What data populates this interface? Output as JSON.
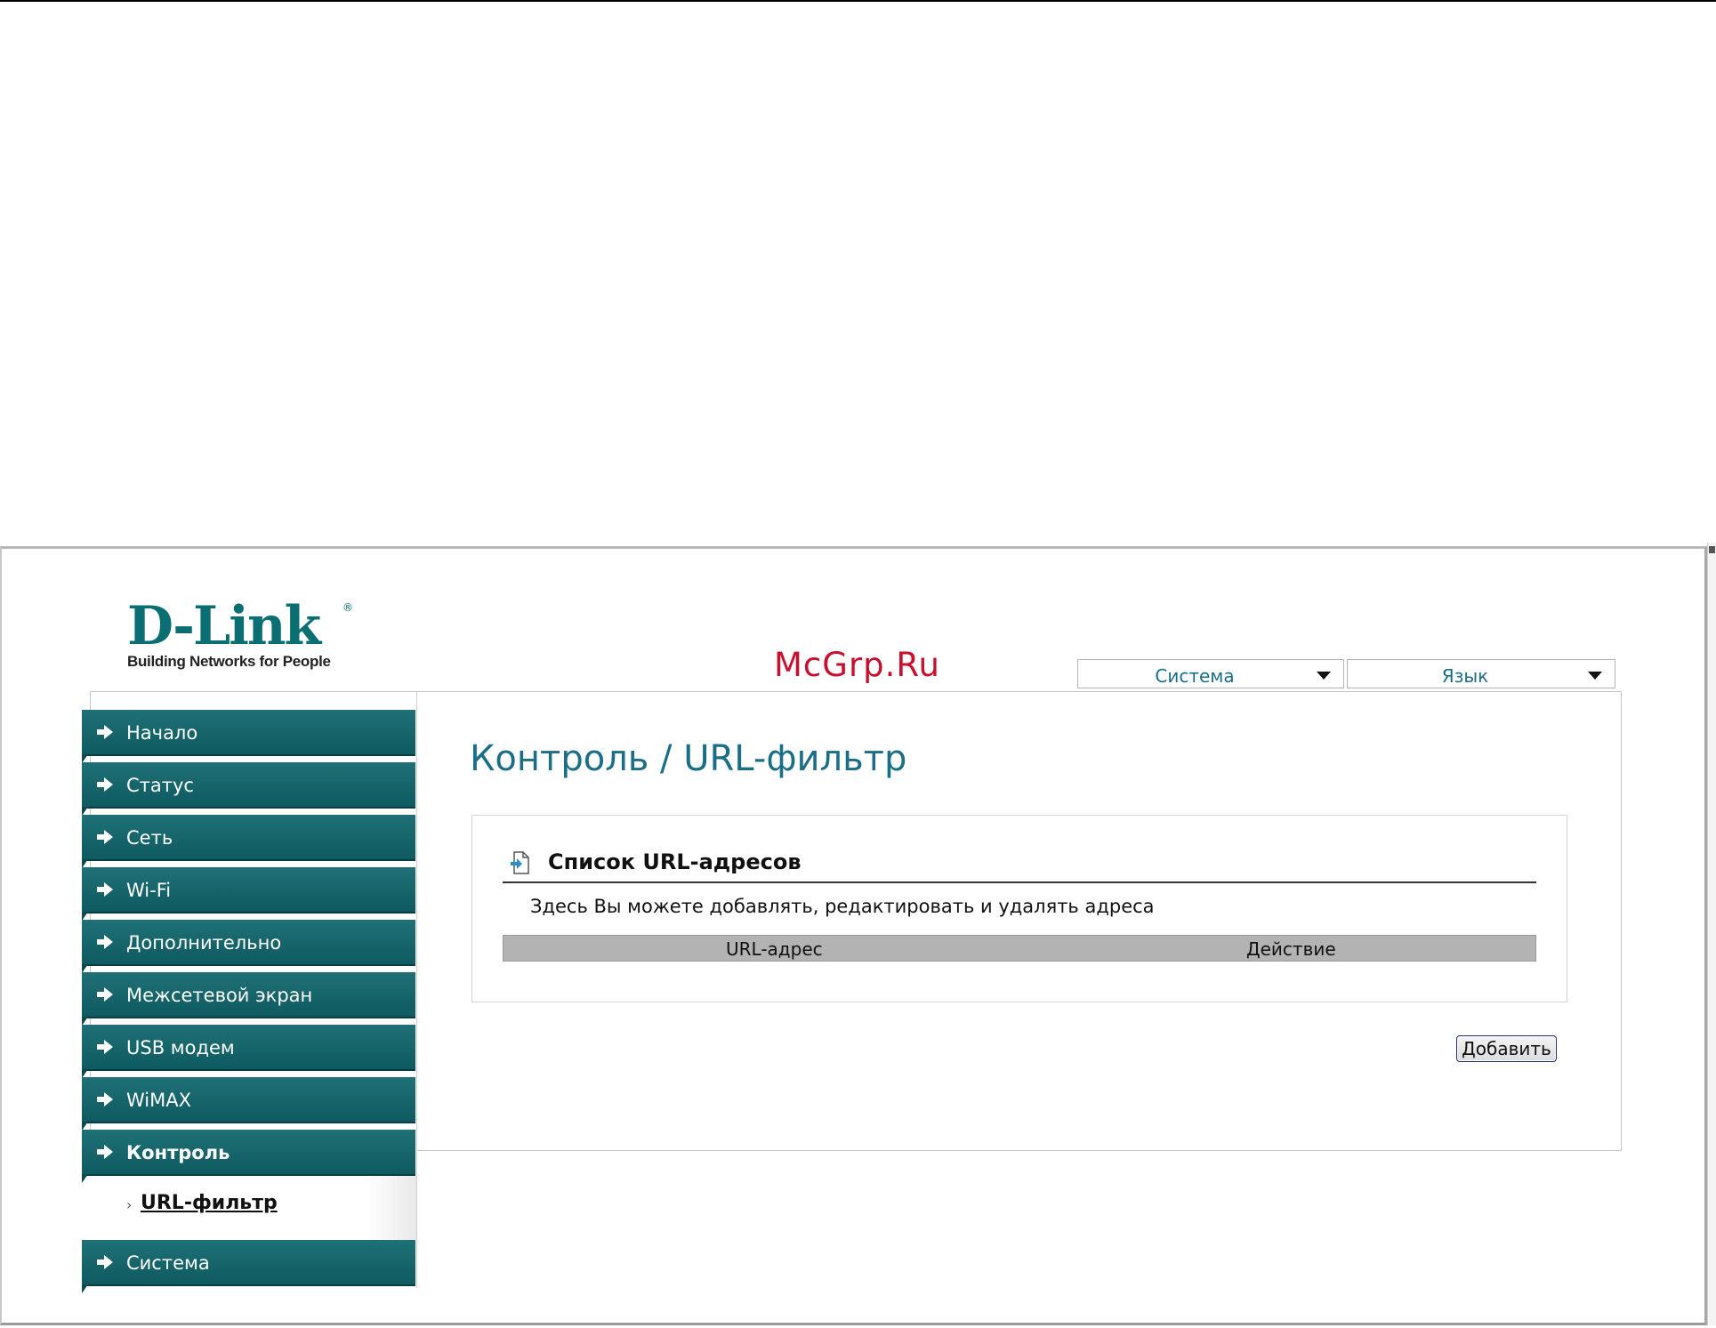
{
  "brand": {
    "name": "D-Link",
    "registered": "®",
    "tagline": "Building Networks for People"
  },
  "watermark": "McGrp.Ru",
  "top_menus": [
    {
      "label": "Система"
    },
    {
      "label": "Язык"
    }
  ],
  "sidebar": {
    "items": [
      {
        "label": "Начало"
      },
      {
        "label": "Статус"
      },
      {
        "label": "Сеть"
      },
      {
        "label": "Wi-Fi"
      },
      {
        "label": "Дополнительно"
      },
      {
        "label": "Межсетевой экран"
      },
      {
        "label": "USB модем"
      },
      {
        "label": "WiMAX"
      },
      {
        "label": "Контроль"
      },
      {
        "label": "Система"
      }
    ],
    "sub_item": {
      "chevron": "›",
      "label": "URL-фильтр"
    }
  },
  "page": {
    "title": "Контроль  / URL-фильтр"
  },
  "section": {
    "title": "Список URL-адресов",
    "description": "Здесь Вы можете добавлять, редактировать и удалять адреса",
    "columns": [
      "URL-адрес",
      "Действие"
    ],
    "rows": []
  },
  "actions": {
    "add_label": "Добавить"
  },
  "colors": {
    "nav_bg": "#15666c",
    "title": "#1a6e86",
    "watermark": "#c8102e"
  }
}
